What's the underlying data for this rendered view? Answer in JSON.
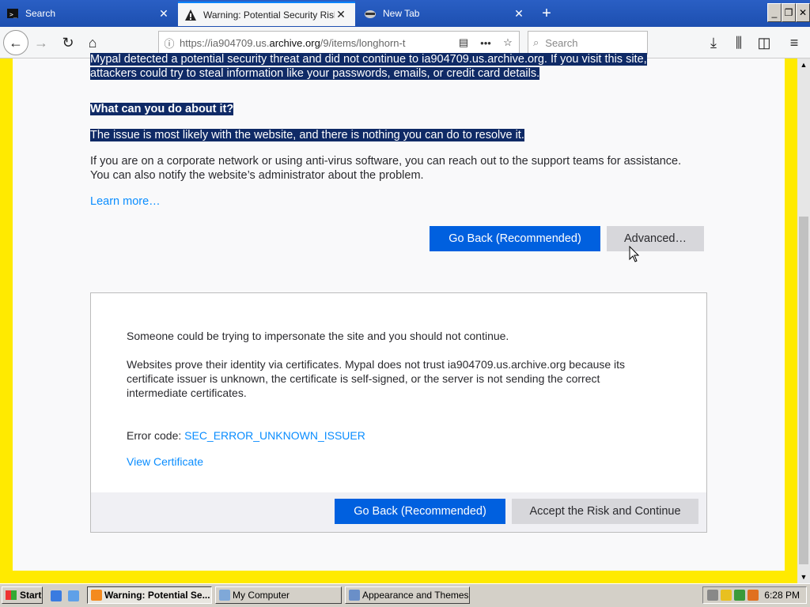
{
  "tabs": [
    {
      "label": "Search",
      "icon": "terminal-icon"
    },
    {
      "label": "Warning: Potential Security Risk Ahead",
      "icon": "warning-icon"
    },
    {
      "label": "New Tab",
      "icon": "raccoon-icon"
    }
  ],
  "nav": {
    "url_prefix": "https://ia904709.us.",
    "url_domain": "archive.org",
    "url_path": "/9/items/longhorn-t",
    "search_placeholder": "Search"
  },
  "page": {
    "intro_line1": "Mypal detected a potential security threat and did not continue to ia904709.us.archive.org. If you visit this site,",
    "intro_line2": "attackers could try to steal information like your passwords, emails, or credit card details.",
    "heading": "What can you do about it?",
    "issue": "The issue is most likely with the website, and there is nothing you can do to resolve it.",
    "corp_line1": "If you are on a corporate network or using anti-virus software, you can reach out to the support teams for assistance.",
    "corp_line2": "You can also notify the website’s administrator about the problem.",
    "learn_more": "Learn more…",
    "go_back": "Go Back (Recommended)",
    "advanced": "Advanced…"
  },
  "advanced_panel": {
    "impersonate": "Someone could be trying to impersonate the site and you should not continue.",
    "cert_line1": "Websites prove their identity via certificates. Mypal does not trust ia904709.us.archive.org because its",
    "cert_line2": "certificate issuer is unknown, the certificate is self-signed, or the server is not sending the correct",
    "cert_line3": "intermediate certificates.",
    "error_label": "Error code: ",
    "error_code": "SEC_ERROR_UNKNOWN_ISSUER",
    "view_cert": "View Certificate",
    "go_back": "Go Back (Recommended)",
    "accept": "Accept the Risk and Continue"
  },
  "taskbar": {
    "start": "Start",
    "items": [
      "Warning: Potential Se...",
      "My Computer",
      "Appearance and Themes"
    ],
    "clock": "6:28 PM"
  },
  "colors": {
    "accent": "#0060df",
    "highlight": "#0f2a66",
    "link": "#0a8dff",
    "frame": "#ffea00"
  }
}
